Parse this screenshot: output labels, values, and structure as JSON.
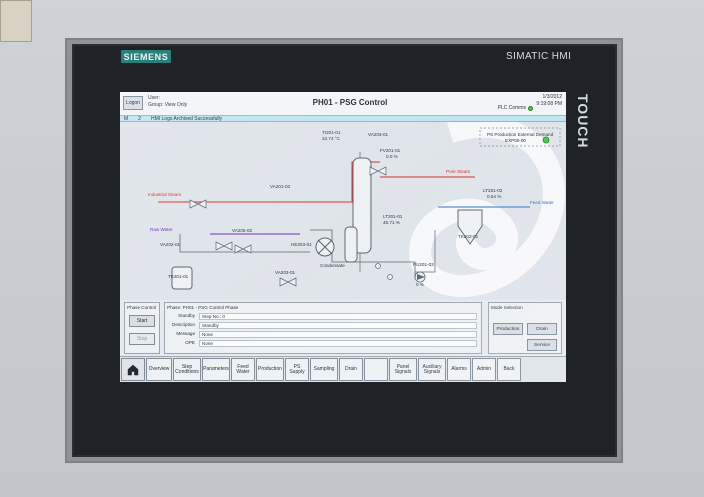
{
  "device": {
    "brand_left": "SIEMENS",
    "brand_right": "SIMATIC HMI",
    "touch_label": "TOUCH"
  },
  "hmi": {
    "topbar": {
      "logon_label": "Logon",
      "user_label": "User:",
      "group_label": "Group:",
      "group_value": "View Only",
      "title": "PH01 - PSG Control",
      "date": "1/3/2012",
      "time": "9:19:08 PM",
      "plc_label": "PLC Comms"
    },
    "alarm": {
      "col1": "M",
      "col2": "2",
      "message": "HMI Logs Archived Successfully"
    },
    "diagram": {
      "labels": {
        "industrial_steam": "Industrial Steam",
        "pure_steam": "Pure Steam",
        "feed_water": "Feed Water",
        "raw_water": "Raw Water",
        "condensate": "Condensate",
        "hx": "HE203-01",
        "ps_ext_demand": "PS Production External Demand",
        "ps_ext_demand_tag": "EXP00-00",
        "tag_ti": "TI201-01",
        "tag_ti_val": "22.74 °C",
        "tag_va_1": "VA203-01",
        "tag_fv": "FV201-01",
        "tag_fv_val": "0.0 %",
        "tag_va_top": "VA201-03",
        "tag_valve_mid": "VA205-02",
        "tag_valve_low": "VA203-01",
        "tag_raw": "VA202-01",
        "tag_tank_left": "TK201-01",
        "tag_tank_right": "TK202-01",
        "tag_pump": "PU201-03",
        "tag_val_pump": "0 %",
        "tag_level": "LT201-01",
        "tag_level_val": "45.71 %",
        "tag_fill": "LT201-02",
        "tag_fill_val": "0.54 %"
      }
    },
    "bottom": {
      "phase_control_title": "Phase Control",
      "start_label": "Start",
      "stop_label": "Stop",
      "phase_panel_title": "Phase: PH01 - PSG Control Phase",
      "rows": [
        {
          "k": "Standby",
          "v": "Step No.: 0"
        },
        {
          "k": "Description",
          "v": "Standby"
        },
        {
          "k": "Message",
          "v": "None"
        },
        {
          "k": "OPE",
          "v": "None"
        }
      ],
      "mode_selection_title": "Mode Selection",
      "mode_production": "Production",
      "mode_drain": "Drain",
      "mode_service": "Service"
    },
    "navbar": {
      "items": [
        {
          "label": "Overview"
        },
        {
          "label": "Step Conditions"
        },
        {
          "label": "Parameters"
        },
        {
          "label": "Feed Water"
        },
        {
          "label": "Production"
        },
        {
          "label": "PS Supply"
        },
        {
          "label": "Sampling"
        },
        {
          "label": "Drain"
        },
        {
          "label": ""
        },
        {
          "label": "Panel Signals"
        },
        {
          "label": "Auxiliary Signals"
        },
        {
          "label": "Alarms"
        },
        {
          "label": "Admin"
        },
        {
          "label": "Back"
        }
      ]
    }
  }
}
